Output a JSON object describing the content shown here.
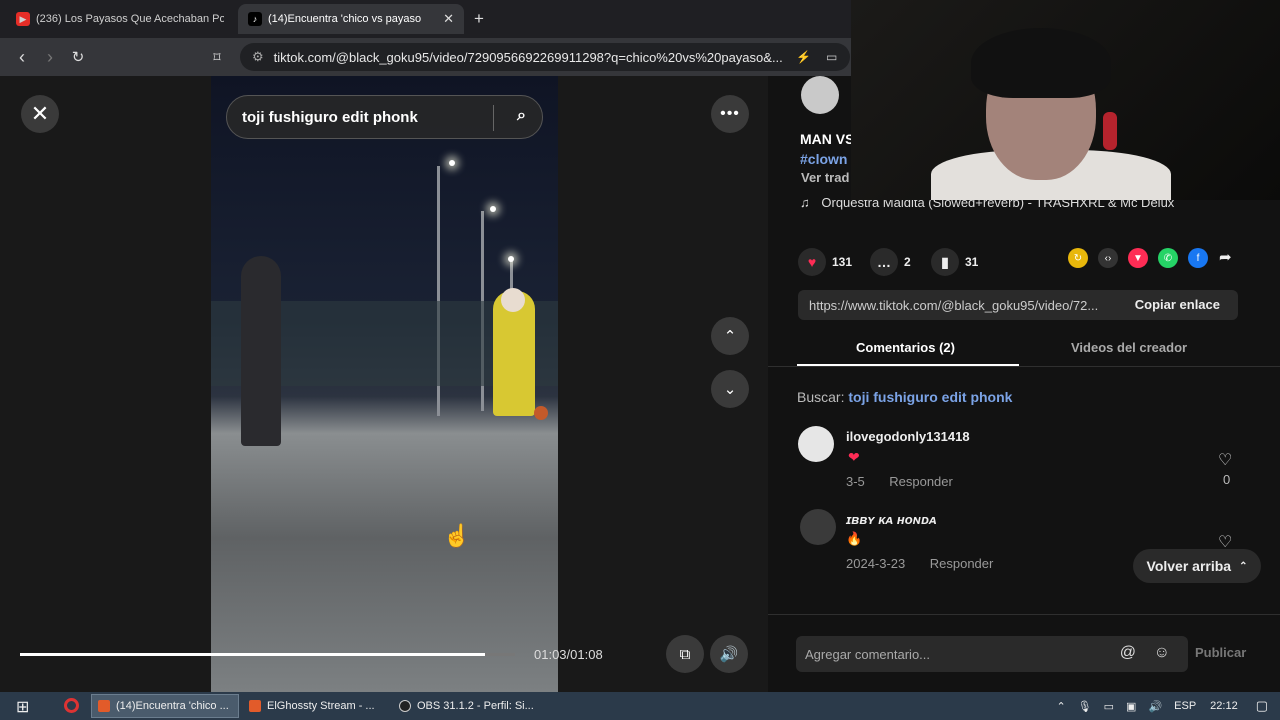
{
  "browser": {
    "tabs": [
      {
        "title": "(236) Los Payasos Que Acechaban Po",
        "active": false
      },
      {
        "title": "(14)Encuentra 'chico vs payaso",
        "active": true
      }
    ],
    "new_tab_glyph": "+",
    "url": "tiktok.com/@black_goku95/video/7290956692269911298?q=chico%20vs%20payaso&..."
  },
  "video": {
    "search_text": "toji fushiguro edit phonk",
    "time": "01:03/01:08",
    "progress": 0.94
  },
  "panel": {
    "caption_line1": "MAN VS",
    "caption_hashtag": "#clown",
    "caption_translate": "Ver trad",
    "music": "Orquestra Maldita (Slowed+reverb) - TRASHXRL & Mc Delux",
    "likes": "131",
    "comments": "2",
    "saves": "31",
    "link": "https://www.tiktok.com/@black_goku95/video/72...",
    "copy_label": "Copiar enlace",
    "tab_comments": "Comentarios (2)",
    "tab_videos": "Videos del creador",
    "buscar_label": "Buscar:",
    "buscar_query": "toji fushiguro edit phonk",
    "comment_list": [
      {
        "user": "ilovegodonly131418",
        "text": "❤",
        "date": "3-5",
        "reply": "Responder",
        "likes": "0"
      },
      {
        "user": "ɪʙʙʏ ᴋᴀ ʜᴏɴᴅᴀ",
        "text": "🔥",
        "date": "2024-3-23",
        "reply": "Responder",
        "likes": ""
      }
    ],
    "back_to_top": "Volver arriba",
    "comment_placeholder": "Agregar comentario...",
    "publish": "Publicar"
  },
  "taskbar": {
    "items": [
      "(14)Encuentra 'chico ...",
      "ElGhossty Stream - ...",
      "OBS 31.1.2 - Perfil: Si..."
    ],
    "lang": "ESP",
    "time": "22:12"
  }
}
